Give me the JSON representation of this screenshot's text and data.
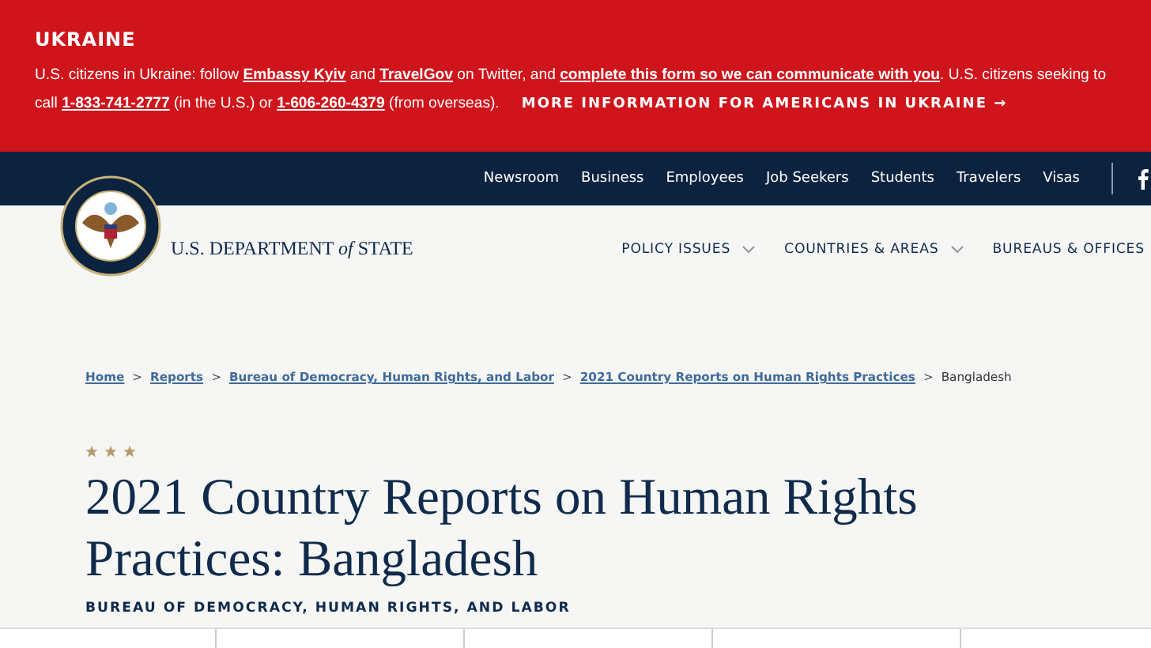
{
  "alert": {
    "title": "UKRAINE",
    "line_1": [
      {
        "text": "U.S. citizens in Ukraine: follow ",
        "link": false
      },
      {
        "text": "Embassy Kyiv",
        "link": true
      },
      {
        "text": " and ",
        "link": false
      },
      {
        "text": "TravelGov",
        "link": true
      },
      {
        "text": " on Twitter, and ",
        "link": false
      },
      {
        "text": "complete this form so we can communicate with you",
        "link": true
      },
      {
        "text": ". U.S. citizens seeking to",
        "link": false
      }
    ],
    "line_2": [
      {
        "text": "call ",
        "link": false
      },
      {
        "text": "1-833-741-2777",
        "link": true
      },
      {
        "text": " (in the U.S.) or ",
        "link": false
      },
      {
        "text": "1-606-260-4379",
        "link": true
      },
      {
        "text": " (from overseas).",
        "link": false
      }
    ],
    "more_link": "MORE INFORMATION FOR AMERICANS IN UKRAINE →"
  },
  "top_nav": [
    "Newsroom",
    "Business",
    "Employees",
    "Job Seekers",
    "Students",
    "Travelers",
    "Visas"
  ],
  "site_title": {
    "main": "U.S. DEPARTMENT",
    "of": "of",
    "end": "STATE"
  },
  "main_nav": [
    "POLICY ISSUES",
    "COUNTRIES & AREAS",
    "BUREAUS & OFFICES"
  ],
  "breadcrumb": {
    "links": [
      {
        "label": "Home",
        "separator": ">"
      },
      {
        "label": "Reports",
        "separator": ">"
      },
      {
        "label": "Bureau of Democracy, Human Rights, and Labor",
        "separator": ">"
      },
      {
        "label": "2021 Country Reports on Human Rights Practices",
        "separator": ">"
      }
    ],
    "current": "Bangladesh"
  },
  "page_title": "2021 Country Reports on Human Rights Practices: Bangladesh",
  "subtitle": "BUREAU OF DEMOCRACY, HUMAN RIGHTS, AND LABOR"
}
